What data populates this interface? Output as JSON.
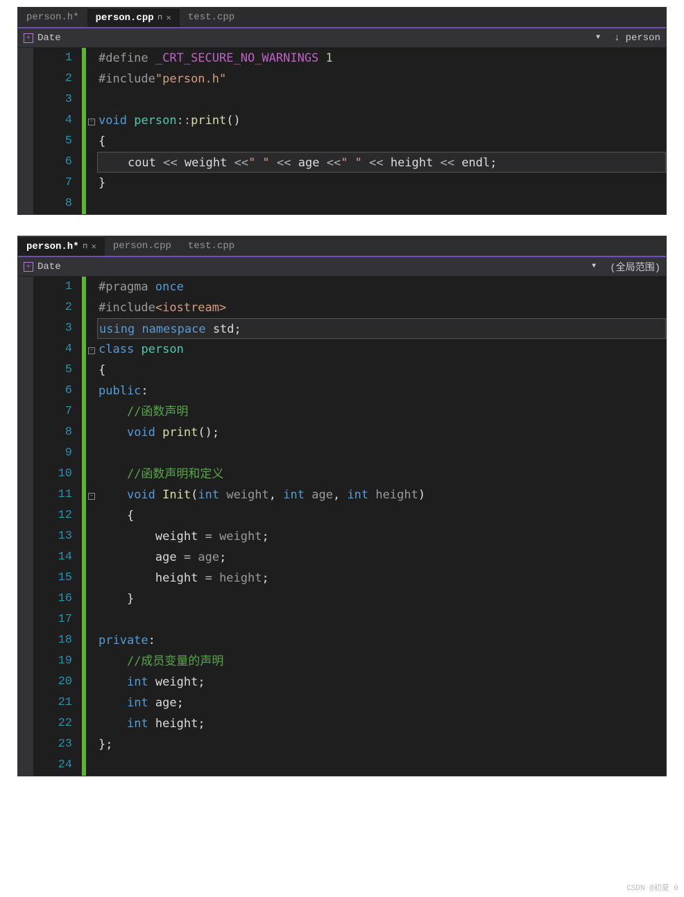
{
  "watermark": "CSDN @初夏 0",
  "top": {
    "tabs": [
      {
        "label": "person.h*",
        "active": false,
        "pinned": false,
        "closable": false
      },
      {
        "label": "person.cpp",
        "active": true,
        "pinned": true,
        "closable": true
      },
      {
        "label": "test.cpp",
        "active": false,
        "pinned": false,
        "closable": false
      }
    ],
    "nav": {
      "left_icon": "+",
      "left": "Date",
      "right": "person"
    },
    "lines": [
      {
        "n": "1",
        "html": "<span class='c-pp'>#define </span><span class='c-macro'>_CRT_SECURE_NO_WARNINGS</span><span class='c-pp'> </span><span class='c-num'>1</span>"
      },
      {
        "n": "2",
        "html": "<span class='c-pp'>#include</span><span class='c-str'>\"person.h\"</span>"
      },
      {
        "n": "3",
        "html": ""
      },
      {
        "n": "4",
        "fold": "-",
        "html": "<span class='c-kw'>void</span> <span class='c-type'>person</span><span class='c-op'>::</span><span class='c-func'>print</span><span class='c-punct'>()</span>"
      },
      {
        "n": "5",
        "html": "<span class='c-punct'>{</span>"
      },
      {
        "n": "6",
        "hl": true,
        "html": "    <span class='c-text'>cout</span> <span class='c-op'>&lt;&lt;</span> <span class='c-text'>weight</span> <span class='c-op'>&lt;&lt;</span><span class='c-str'>\" \"</span> <span class='c-op'>&lt;&lt;</span> <span class='c-text'>age</span> <span class='c-op'>&lt;&lt;</span><span class='c-str'>\" \"</span> <span class='c-op'>&lt;&lt;</span> <span class='c-text'>height</span> <span class='c-op'>&lt;&lt;</span> <span class='c-text'>endl</span><span class='c-punct'>;</span>"
      },
      {
        "n": "7",
        "html": "<span class='c-punct'>}</span>"
      },
      {
        "n": "8",
        "html": ""
      }
    ]
  },
  "bottom": {
    "tabs": [
      {
        "label": "person.h*",
        "active": true,
        "pinned": true,
        "closable": true
      },
      {
        "label": "person.cpp",
        "active": false,
        "pinned": false,
        "closable": false
      },
      {
        "label": "test.cpp",
        "active": false,
        "pinned": false,
        "closable": false
      }
    ],
    "nav": {
      "left_icon": "+",
      "left": "Date",
      "right": "(全局范围)"
    },
    "lines": [
      {
        "n": "1",
        "html": "<span class='c-pp'>#pragma </span><span class='c-kw'>once</span>"
      },
      {
        "n": "2",
        "html": "<span class='c-pp'>#include</span><span class='c-str'>&lt;iostream&gt;</span>"
      },
      {
        "n": "3",
        "hl": true,
        "html": "<span class='c-kw'>using</span> <span class='c-kw'>namespace</span> <span class='c-text'>std</span><span class='c-punct'>;</span>"
      },
      {
        "n": "4",
        "fold": "-",
        "html": "<span class='c-kw'>class</span> <span class='c-type'>person</span>"
      },
      {
        "n": "5",
        "html": "<span class='c-punct'>{</span>"
      },
      {
        "n": "6",
        "html": "<span class='c-kw'>public</span><span class='c-punct'>:</span>"
      },
      {
        "n": "7",
        "html": "    <span class='c-comment'>//函数声明</span>"
      },
      {
        "n": "8",
        "html": "    <span class='c-kw'>void</span> <span class='c-func'>print</span><span class='c-punct'>();</span>"
      },
      {
        "n": "9",
        "yellow": true,
        "html": ""
      },
      {
        "n": "10",
        "html": "    <span class='c-comment'>//函数声明和定义</span>"
      },
      {
        "n": "11",
        "fold": "-",
        "html": "    <span class='c-kw'>void</span> <span class='c-func'>Init</span><span class='c-punct'>(</span><span class='c-kw'>int</span> <span class='c-param'>weight</span><span class='c-punct'>,</span> <span class='c-kw'>int</span> <span class='c-param'>age</span><span class='c-punct'>,</span> <span class='c-kw'>int</span> <span class='c-param'>height</span><span class='c-punct'>)</span>"
      },
      {
        "n": "12",
        "html": "    <span class='c-punct'>{</span>"
      },
      {
        "n": "13",
        "yellow": true,
        "html": "        <span class='c-text'>weight</span> <span class='c-op'>=</span> <span class='c-param'>weight</span><span class='c-punct'>;</span>"
      },
      {
        "n": "14",
        "html": "        <span class='c-text'>age</span> <span class='c-op'>=</span> <span class='c-param'>age</span><span class='c-punct'>;</span>"
      },
      {
        "n": "15",
        "html": "        <span class='c-text'>height</span> <span class='c-op'>=</span> <span class='c-param'>height</span><span class='c-punct'>;</span>"
      },
      {
        "n": "16",
        "html": "    <span class='c-punct'>}</span>"
      },
      {
        "n": "17",
        "html": ""
      },
      {
        "n": "18",
        "html": "<span class='c-kw'>private</span><span class='c-punct'>:</span>"
      },
      {
        "n": "19",
        "html": "    <span class='c-comment'>//成员变量的声明</span>"
      },
      {
        "n": "20",
        "html": "    <span class='c-kw'>int</span> <span class='c-text'>weight</span><span class='c-punct'>;</span>"
      },
      {
        "n": "21",
        "html": "    <span class='c-kw'>int</span> <span class='c-text'>age</span><span class='c-punct'>;</span>"
      },
      {
        "n": "22",
        "html": "    <span class='c-kw'>int</span> <span class='c-text'>height</span><span class='c-punct'>;</span>"
      },
      {
        "n": "23",
        "html": "<span class='c-punct'>};</span>"
      },
      {
        "n": "24",
        "html": ""
      }
    ]
  }
}
